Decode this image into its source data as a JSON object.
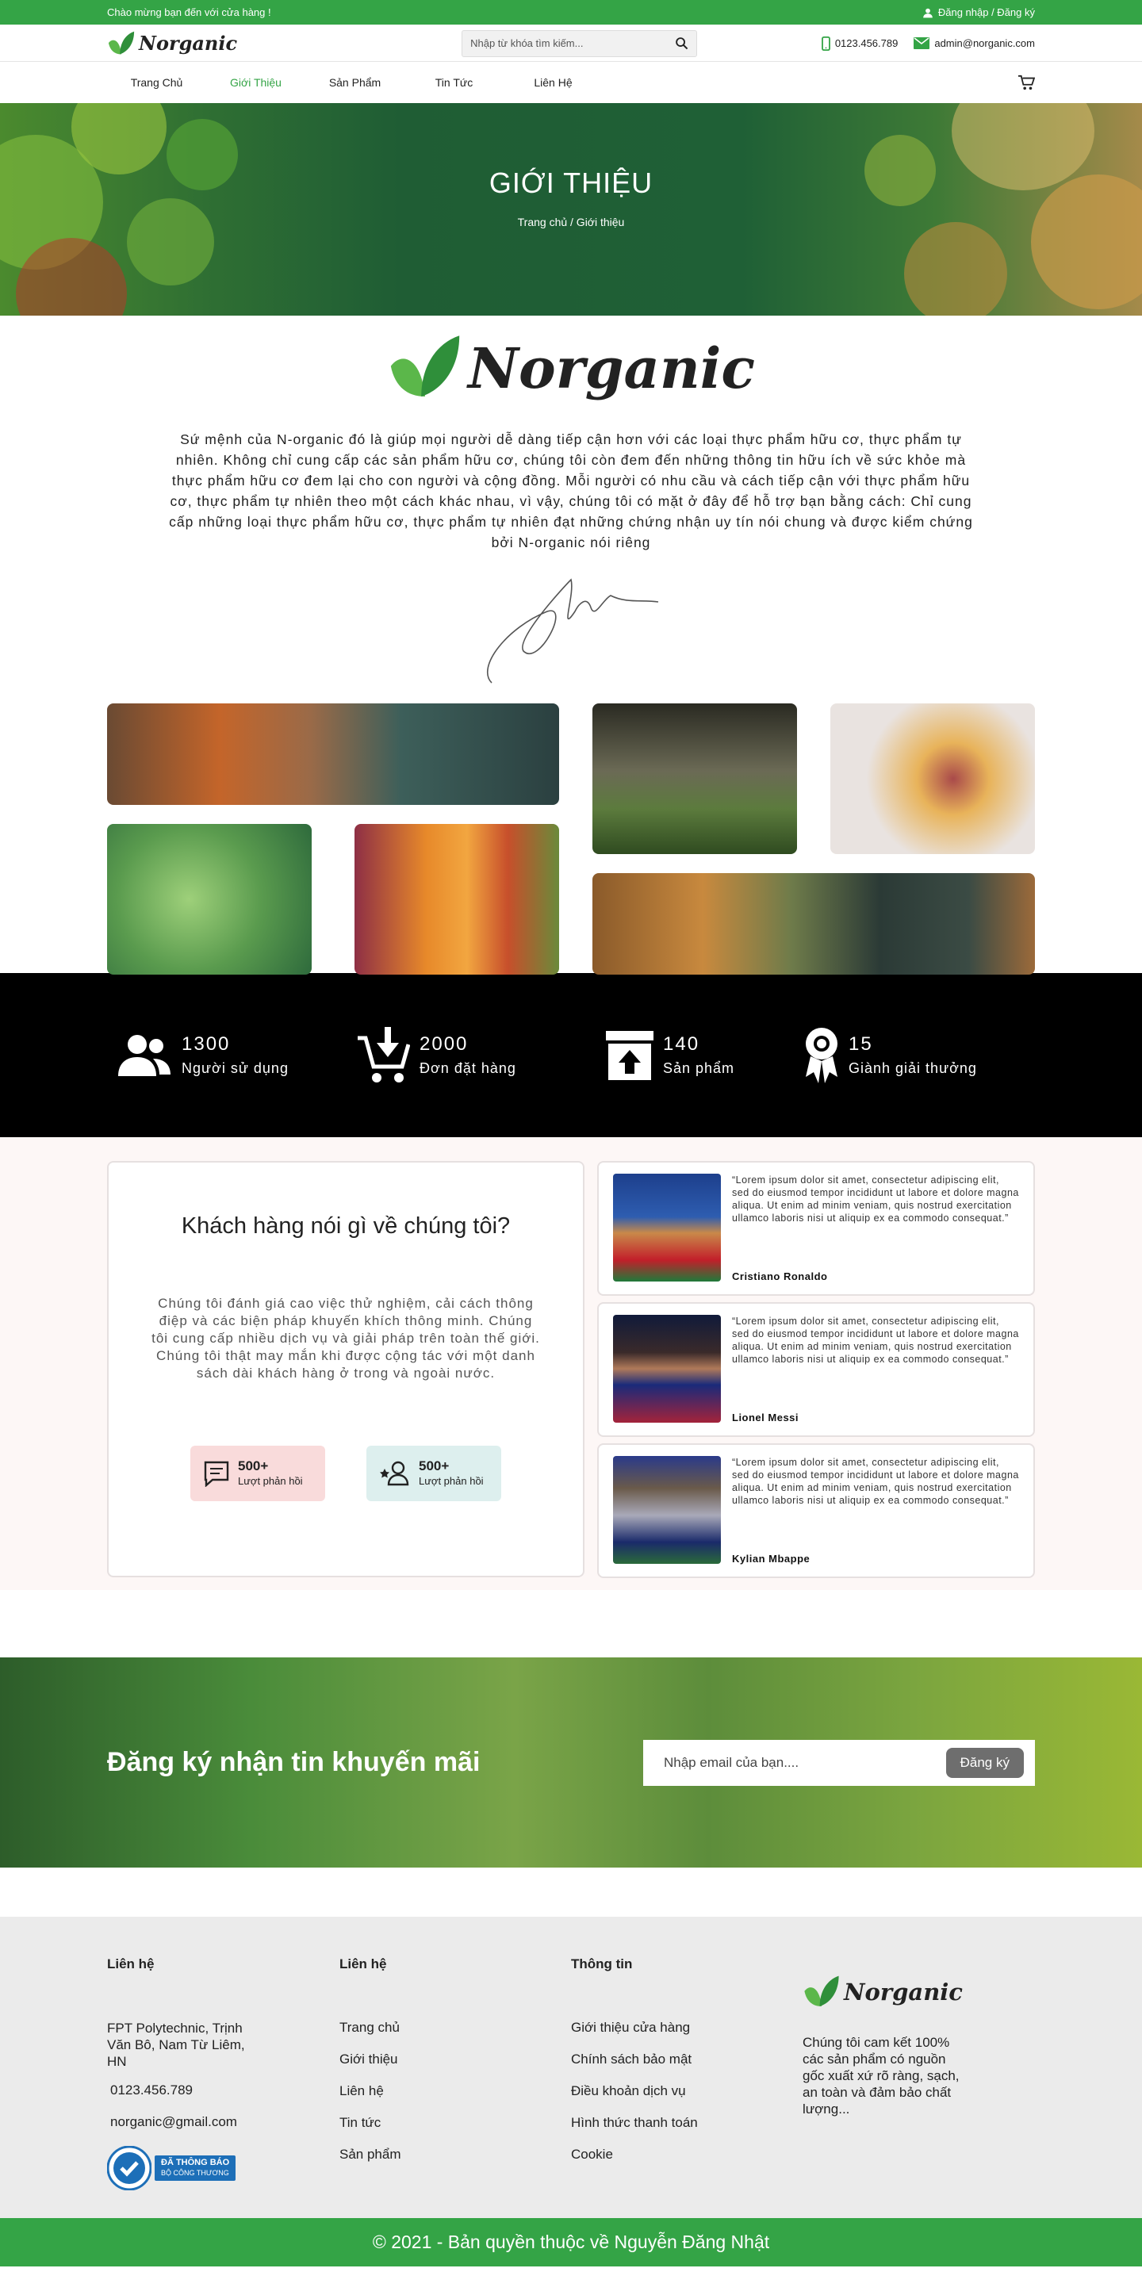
{
  "topbar": {
    "welcome": "Chào mừng bạn đến với cửa hàng !",
    "account": "Đăng nhập / Đăng ký"
  },
  "header": {
    "logo": "Norganic",
    "search_placeholder": "Nhập từ khóa tìm kiếm...",
    "phone": "0123.456.789",
    "email": "admin@norganic.com"
  },
  "nav": {
    "items": [
      "Trang Chủ",
      "Giới Thiệu",
      "Sản Phẩm",
      "Tin Tức",
      "Liên Hệ"
    ],
    "active": "Giới Thiệu"
  },
  "hero": {
    "title": "GIỚI THIỆU",
    "breadcrumb": "Trang chủ / Giới thiệu"
  },
  "about": {
    "logo": "Norganic",
    "mission": "Sứ mệnh của N-organic đó là giúp mọi người dễ dàng tiếp cận hơn với các loại thực phẩm hữu cơ, thực phẩm tự nhiên. Không chỉ cung cấp các sản phẩm hữu cơ, chúng tôi còn đem đến những thông tin hữu ích về sức khỏe mà thực phẩm hữu cơ đem lại cho con người và cộng đồng. Mỗi người có nhu cầu và cách tiếp cận với thực phẩm hữu cơ, thực phẩm tự nhiên theo một cách khác nhau, vì vậy, chúng tôi có mặt ở đây để hỗ trợ bạn bằng cách: Chỉ cung cấp những loại thực phẩm hữu cơ, thực phẩm tự nhiên đạt những chứng nhận uy tín nói chung và được kiểm chứng bởi N-organic nói riêng"
  },
  "stats": [
    {
      "num": "1300",
      "label": "Người sử dụng",
      "icon": "users-icon"
    },
    {
      "num": "2000",
      "label": "Đơn đặt hàng",
      "icon": "cart-download-icon"
    },
    {
      "num": "140",
      "label": "Sản phẩm",
      "icon": "archive-box-icon"
    },
    {
      "num": "15",
      "label": "Giành giải thưởng",
      "icon": "award-ribbon-icon"
    }
  ],
  "testimonials": {
    "title": "Khách hàng nói gì về chúng tôi?",
    "desc": "Chúng tôi đánh giá cao việc thử nghiệm, cải cách thông điệp và các biện pháp khuyến khích thông minh. Chúng tôi cung cấp nhiều dịch vụ và giải pháp trên toàn thế giới. Chúng tôi thật may mắn khi được cộng tác với một danh sách dài khách hàng ở trong và ngoài nước.",
    "badges": [
      {
        "num": "500+",
        "label": "Lượt phản hồi",
        "color": "#f9dbdb"
      },
      {
        "num": "500+",
        "label": "Lượt phản hồi",
        "color": "#ddefee"
      }
    ],
    "items": [
      {
        "quote": "“Lorem ipsum dolor sit amet, consectetur adipiscing elit, sed do eiusmod tempor incididunt ut labore et dolore magna aliqua. Ut enim ad minim veniam, quis nostrud exercitation ullamco laboris nisi ut aliquip ex ea commodo consequat.”",
        "name": "Cristiano Ronaldo"
      },
      {
        "quote": "“Lorem ipsum dolor sit amet, consectetur adipiscing elit, sed do eiusmod tempor incididunt ut labore et dolore magna aliqua. Ut enim ad minim veniam, quis nostrud exercitation ullamco laboris nisi ut aliquip ex ea commodo consequat.”",
        "name": "Lionel Messi"
      },
      {
        "quote": "“Lorem ipsum dolor sit amet, consectetur adipiscing elit, sed do eiusmod tempor incididunt ut labore et dolore magna aliqua. Ut enim ad minim veniam, quis nostrud exercitation ullamco laboris nisi ut aliquip ex ea commodo consequat.”",
        "name": "Kylian Mbappe"
      }
    ]
  },
  "newsletter": {
    "title": "Đăng ký nhận tin khuyến mãi",
    "placeholder": "Nhập email của bạn....",
    "button": "Đăng ký"
  },
  "footer": {
    "col1": {
      "title": "Liên hệ",
      "address": "FPT Polytechnic, Trịnh Văn Bô, Nam Từ Liêm, HN",
      "phone": "0123.456.789",
      "email": "norganic@gmail.com",
      "cert_line1": "ĐÃ THÔNG BÁO",
      "cert_line2": "BỘ CÔNG THƯƠNG"
    },
    "col2": {
      "title": "Liên hệ",
      "links": [
        "Trang chủ",
        "Giới thiệu",
        "Liên hệ",
        "Tin tức",
        "Sản phẩm"
      ]
    },
    "col3": {
      "title": "Thông tin",
      "links": [
        "Giới thiệu cửa hàng",
        "Chính sách bảo mật",
        "Điều khoản dịch vụ",
        "Hình thức thanh toán",
        "Cookie"
      ]
    },
    "col4": {
      "logo": "Norganic",
      "desc": "Chúng tôi cam kết 100% các sản phẩm có nguồn gốc xuất xứ rõ ràng, sạch, an toàn và đảm bảo chất lượng..."
    },
    "copyright": "© 2021 - Bản quyền thuộc về Nguyễn Đăng Nhật"
  },
  "colors": {
    "brand": "#34a446",
    "stats_bg": "#000000",
    "footer_bg": "#ebebeb"
  }
}
